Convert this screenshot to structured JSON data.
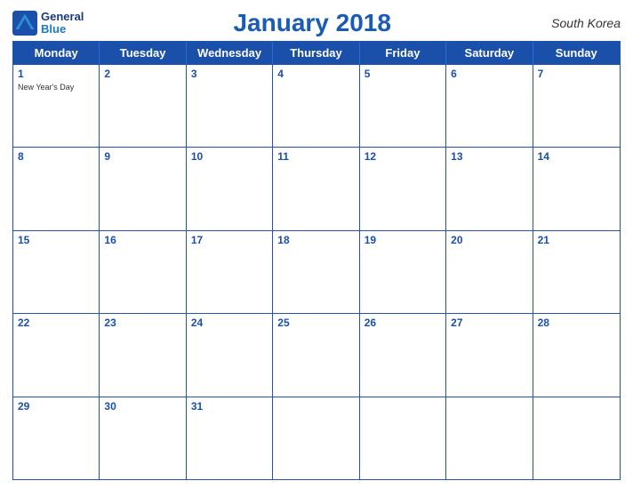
{
  "logo": {
    "general": "General",
    "blue": "Blue"
  },
  "header": {
    "title": "January 2018",
    "country": "South Korea"
  },
  "weekdays": [
    "Monday",
    "Tuesday",
    "Wednesday",
    "Thursday",
    "Friday",
    "Saturday",
    "Sunday"
  ],
  "weeks": [
    [
      {
        "day": "1",
        "event": "New Year's Day"
      },
      {
        "day": "2",
        "event": ""
      },
      {
        "day": "3",
        "event": ""
      },
      {
        "day": "4",
        "event": ""
      },
      {
        "day": "5",
        "event": ""
      },
      {
        "day": "6",
        "event": ""
      },
      {
        "day": "7",
        "event": ""
      }
    ],
    [
      {
        "day": "8",
        "event": ""
      },
      {
        "day": "9",
        "event": ""
      },
      {
        "day": "10",
        "event": ""
      },
      {
        "day": "11",
        "event": ""
      },
      {
        "day": "12",
        "event": ""
      },
      {
        "day": "13",
        "event": ""
      },
      {
        "day": "14",
        "event": ""
      }
    ],
    [
      {
        "day": "15",
        "event": ""
      },
      {
        "day": "16",
        "event": ""
      },
      {
        "day": "17",
        "event": ""
      },
      {
        "day": "18",
        "event": ""
      },
      {
        "day": "19",
        "event": ""
      },
      {
        "day": "20",
        "event": ""
      },
      {
        "day": "21",
        "event": ""
      }
    ],
    [
      {
        "day": "22",
        "event": ""
      },
      {
        "day": "23",
        "event": ""
      },
      {
        "day": "24",
        "event": ""
      },
      {
        "day": "25",
        "event": ""
      },
      {
        "day": "26",
        "event": ""
      },
      {
        "day": "27",
        "event": ""
      },
      {
        "day": "28",
        "event": ""
      }
    ],
    [
      {
        "day": "29",
        "event": ""
      },
      {
        "day": "30",
        "event": ""
      },
      {
        "day": "31",
        "event": ""
      },
      {
        "day": "",
        "event": ""
      },
      {
        "day": "",
        "event": ""
      },
      {
        "day": "",
        "event": ""
      },
      {
        "day": "",
        "event": ""
      }
    ]
  ],
  "colors": {
    "header_bg": "#1a4faa",
    "accent": "#1a5bb5",
    "border": "#2255aa"
  }
}
